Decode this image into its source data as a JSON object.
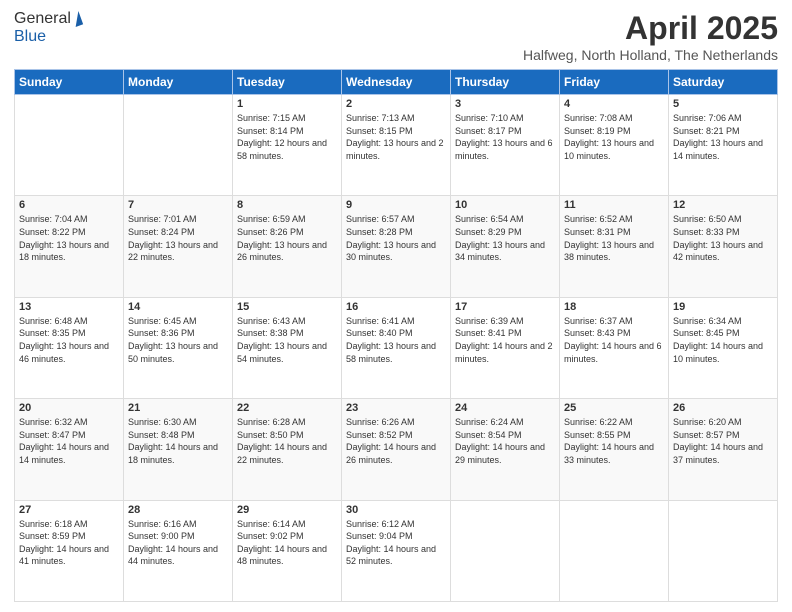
{
  "logo": {
    "line1": "General",
    "line2": "Blue"
  },
  "title": {
    "month_year": "April 2025",
    "location": "Halfweg, North Holland, The Netherlands"
  },
  "days_of_week": [
    "Sunday",
    "Monday",
    "Tuesday",
    "Wednesday",
    "Thursday",
    "Friday",
    "Saturday"
  ],
  "weeks": [
    [
      {
        "day": "",
        "info": ""
      },
      {
        "day": "",
        "info": ""
      },
      {
        "day": "1",
        "info": "Sunrise: 7:15 AM\nSunset: 8:14 PM\nDaylight: 12 hours and 58 minutes."
      },
      {
        "day": "2",
        "info": "Sunrise: 7:13 AM\nSunset: 8:15 PM\nDaylight: 13 hours and 2 minutes."
      },
      {
        "day": "3",
        "info": "Sunrise: 7:10 AM\nSunset: 8:17 PM\nDaylight: 13 hours and 6 minutes."
      },
      {
        "day": "4",
        "info": "Sunrise: 7:08 AM\nSunset: 8:19 PM\nDaylight: 13 hours and 10 minutes."
      },
      {
        "day": "5",
        "info": "Sunrise: 7:06 AM\nSunset: 8:21 PM\nDaylight: 13 hours and 14 minutes."
      }
    ],
    [
      {
        "day": "6",
        "info": "Sunrise: 7:04 AM\nSunset: 8:22 PM\nDaylight: 13 hours and 18 minutes."
      },
      {
        "day": "7",
        "info": "Sunrise: 7:01 AM\nSunset: 8:24 PM\nDaylight: 13 hours and 22 minutes."
      },
      {
        "day": "8",
        "info": "Sunrise: 6:59 AM\nSunset: 8:26 PM\nDaylight: 13 hours and 26 minutes."
      },
      {
        "day": "9",
        "info": "Sunrise: 6:57 AM\nSunset: 8:28 PM\nDaylight: 13 hours and 30 minutes."
      },
      {
        "day": "10",
        "info": "Sunrise: 6:54 AM\nSunset: 8:29 PM\nDaylight: 13 hours and 34 minutes."
      },
      {
        "day": "11",
        "info": "Sunrise: 6:52 AM\nSunset: 8:31 PM\nDaylight: 13 hours and 38 minutes."
      },
      {
        "day": "12",
        "info": "Sunrise: 6:50 AM\nSunset: 8:33 PM\nDaylight: 13 hours and 42 minutes."
      }
    ],
    [
      {
        "day": "13",
        "info": "Sunrise: 6:48 AM\nSunset: 8:35 PM\nDaylight: 13 hours and 46 minutes."
      },
      {
        "day": "14",
        "info": "Sunrise: 6:45 AM\nSunset: 8:36 PM\nDaylight: 13 hours and 50 minutes."
      },
      {
        "day": "15",
        "info": "Sunrise: 6:43 AM\nSunset: 8:38 PM\nDaylight: 13 hours and 54 minutes."
      },
      {
        "day": "16",
        "info": "Sunrise: 6:41 AM\nSunset: 8:40 PM\nDaylight: 13 hours and 58 minutes."
      },
      {
        "day": "17",
        "info": "Sunrise: 6:39 AM\nSunset: 8:41 PM\nDaylight: 14 hours and 2 minutes."
      },
      {
        "day": "18",
        "info": "Sunrise: 6:37 AM\nSunset: 8:43 PM\nDaylight: 14 hours and 6 minutes."
      },
      {
        "day": "19",
        "info": "Sunrise: 6:34 AM\nSunset: 8:45 PM\nDaylight: 14 hours and 10 minutes."
      }
    ],
    [
      {
        "day": "20",
        "info": "Sunrise: 6:32 AM\nSunset: 8:47 PM\nDaylight: 14 hours and 14 minutes."
      },
      {
        "day": "21",
        "info": "Sunrise: 6:30 AM\nSunset: 8:48 PM\nDaylight: 14 hours and 18 minutes."
      },
      {
        "day": "22",
        "info": "Sunrise: 6:28 AM\nSunset: 8:50 PM\nDaylight: 14 hours and 22 minutes."
      },
      {
        "day": "23",
        "info": "Sunrise: 6:26 AM\nSunset: 8:52 PM\nDaylight: 14 hours and 26 minutes."
      },
      {
        "day": "24",
        "info": "Sunrise: 6:24 AM\nSunset: 8:54 PM\nDaylight: 14 hours and 29 minutes."
      },
      {
        "day": "25",
        "info": "Sunrise: 6:22 AM\nSunset: 8:55 PM\nDaylight: 14 hours and 33 minutes."
      },
      {
        "day": "26",
        "info": "Sunrise: 6:20 AM\nSunset: 8:57 PM\nDaylight: 14 hours and 37 minutes."
      }
    ],
    [
      {
        "day": "27",
        "info": "Sunrise: 6:18 AM\nSunset: 8:59 PM\nDaylight: 14 hours and 41 minutes."
      },
      {
        "day": "28",
        "info": "Sunrise: 6:16 AM\nSunset: 9:00 PM\nDaylight: 14 hours and 44 minutes."
      },
      {
        "day": "29",
        "info": "Sunrise: 6:14 AM\nSunset: 9:02 PM\nDaylight: 14 hours and 48 minutes."
      },
      {
        "day": "30",
        "info": "Sunrise: 6:12 AM\nSunset: 9:04 PM\nDaylight: 14 hours and 52 minutes."
      },
      {
        "day": "",
        "info": ""
      },
      {
        "day": "",
        "info": ""
      },
      {
        "day": "",
        "info": ""
      }
    ]
  ]
}
